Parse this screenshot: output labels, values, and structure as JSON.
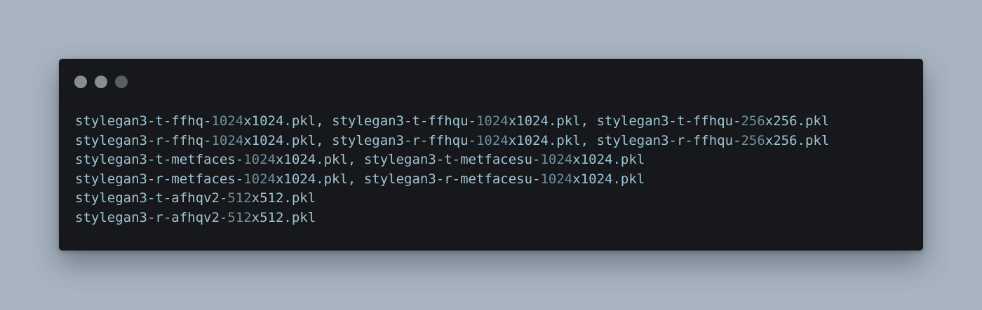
{
  "window": {
    "controls": [
      "dot",
      "dot",
      "dot"
    ],
    "colors": {
      "background": "#16181b",
      "text": "#9fc3d3",
      "number": "#6f8f9c",
      "page": "#a9b4c0"
    }
  },
  "code": {
    "lines": [
      "stylegan3-t-ffhq-1024x1024.pkl, stylegan3-t-ffhqu-1024x1024.pkl, stylegan3-t-ffhqu-256x256.pkl",
      "stylegan3-r-ffhq-1024x1024.pkl, stylegan3-r-ffhqu-1024x1024.pkl, stylegan3-r-ffhqu-256x256.pkl",
      "stylegan3-t-metfaces-1024x1024.pkl, stylegan3-t-metfacesu-1024x1024.pkl",
      "stylegan3-r-metfaces-1024x1024.pkl, stylegan3-r-metfacesu-1024x1024.pkl",
      "stylegan3-t-afhqv2-512x512.pkl",
      "stylegan3-r-afhqv2-512x512.pkl"
    ]
  }
}
